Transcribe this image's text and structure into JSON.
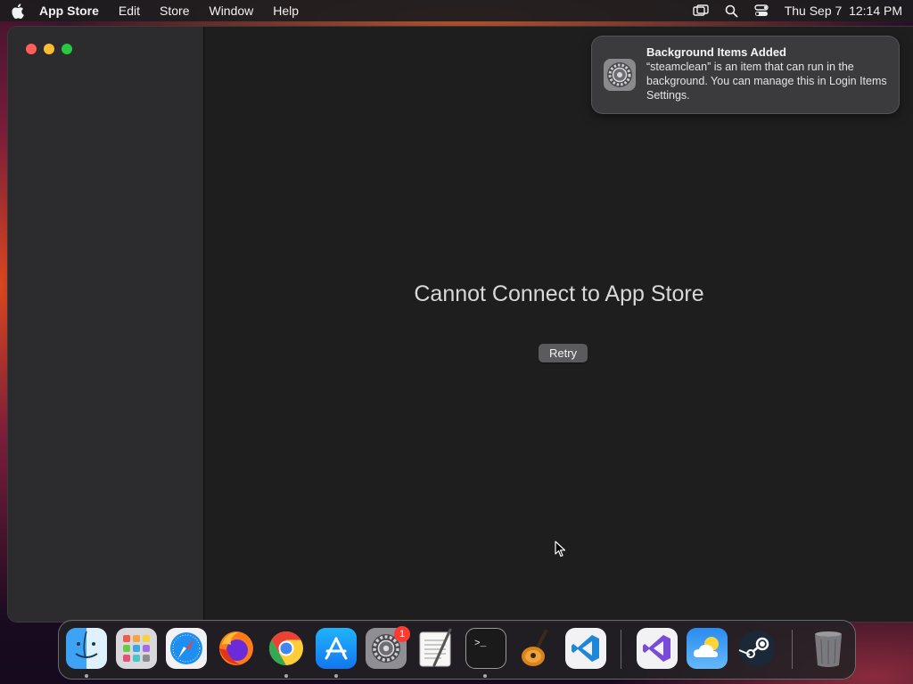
{
  "menubar": {
    "app_name": "App Store",
    "items": [
      "Edit",
      "Store",
      "Window",
      "Help"
    ],
    "datetime": "Thu Sep 7  12:14 PM"
  },
  "main": {
    "error_title": "Cannot Connect to App Store",
    "retry_label": "Retry"
  },
  "notification": {
    "title": "Background Items Added",
    "body": "“steamclean” is an item that can run in the background. You can manage this in Login Items Settings."
  },
  "dock": {
    "items": [
      "Finder",
      "Launchpad",
      "Safari",
      "Firefox",
      "Chrome",
      "App Store",
      "System Settings",
      "TextEdit",
      "Terminal",
      "GarageBand",
      "Visual Studio Code",
      "Visual Studio",
      "Weather",
      "Steam",
      "Trash"
    ],
    "settings_badge": "1"
  },
  "colors": {
    "close": "#ff5f57",
    "minimize": "#febc2e",
    "zoom": "#28c840",
    "badge": "#ff3b30"
  }
}
